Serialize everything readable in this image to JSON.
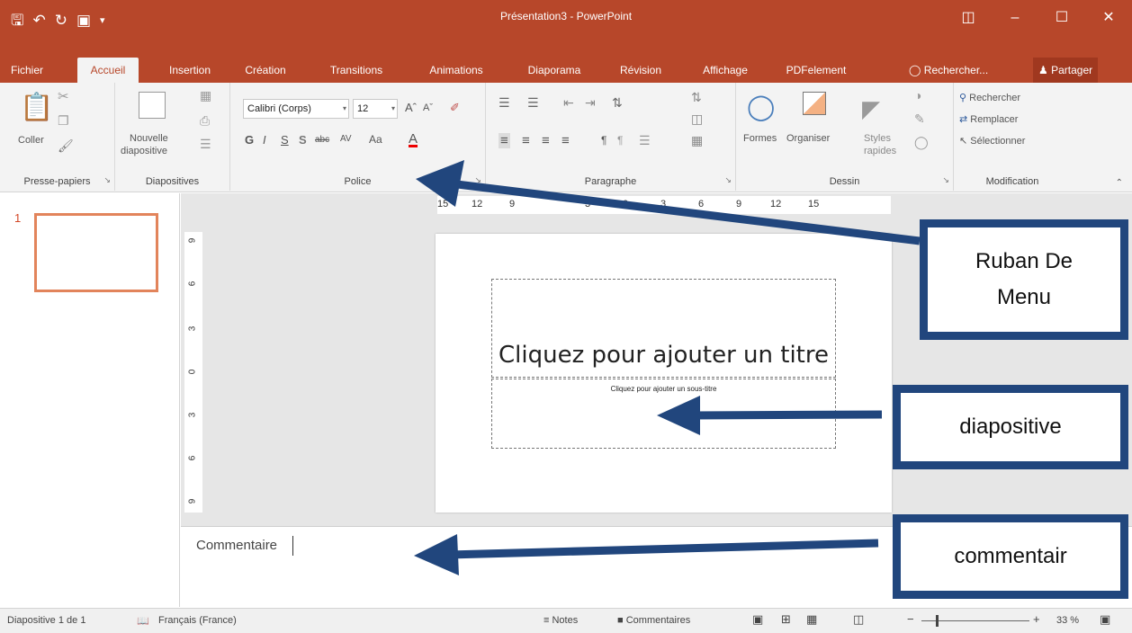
{
  "window": {
    "title": "Présentation3 - PowerPoint",
    "quick_access": [
      "save-icon",
      "undo-icon",
      "redo-icon",
      "slideshow-icon",
      "customize-icon"
    ],
    "controls": [
      "ribbon-display-icon",
      "minimize-icon",
      "maximize-icon",
      "close-icon"
    ]
  },
  "tabs": [
    "Fichier",
    "Accueil",
    "Insertion",
    "Création",
    "Transitions",
    "Animations",
    "Diaporama",
    "Révision",
    "Affichage",
    "PDFelement"
  ],
  "active_tab": "Accueil",
  "tell_me": "Rechercher...",
  "share": "Partager",
  "ribbon": {
    "clipboard": {
      "label": "Presse-papiers",
      "paste": "Coller"
    },
    "slides": {
      "label": "Diapositives",
      "new_slide_line1": "Nouvelle",
      "new_slide_line2": "diapositive"
    },
    "font": {
      "label": "Police",
      "font_name": "Calibri (Corps)",
      "font_size": "12",
      "bold": "G",
      "italic": "I",
      "underline": "S",
      "shadow": "S",
      "strike": "abc",
      "spacing": "AV",
      "case": "Aa",
      "color_letter": "A"
    },
    "paragraph": {
      "label": "Paragraphe"
    },
    "drawing": {
      "label": "Dessin",
      "shapes": "Formes",
      "arrange": "Organiser",
      "styles_line1": "Styles",
      "styles_line2": "rapides"
    },
    "editing": {
      "label": "Modification",
      "find": "Rechercher",
      "replace": "Remplacer",
      "select": "Sélectionner"
    }
  },
  "thumbnail": {
    "number": "1"
  },
  "ruler": {
    "horizontal": [
      "15",
      "12",
      "9",
      "",
      "3",
      "0",
      "3",
      "6",
      "9",
      "12",
      "15"
    ],
    "vertical": [
      "9",
      "6",
      "3",
      "0",
      "3",
      "6",
      "9"
    ]
  },
  "slide": {
    "title_placeholder": "Cliquez pour ajouter un titre",
    "subtitle_placeholder": "Cliquez pour ajouter un sous-titre"
  },
  "notes": {
    "text": "Commentaire"
  },
  "status": {
    "slide_info": "Diapositive 1 de 1",
    "language": "Français (France)",
    "notes": "Notes",
    "comments": "Commentaires",
    "zoom": "33 %",
    "zoom_level_percent": 33
  },
  "annotations": {
    "ribbon_line1": "Ruban De",
    "ribbon_line2": "Menu",
    "slide": "diapositive",
    "notes": "commentair"
  },
  "colors": {
    "accent": "#b7472a",
    "callout_border": "#21467d",
    "arrow": "#21467d",
    "thumbnail_border": "#e2845b"
  }
}
